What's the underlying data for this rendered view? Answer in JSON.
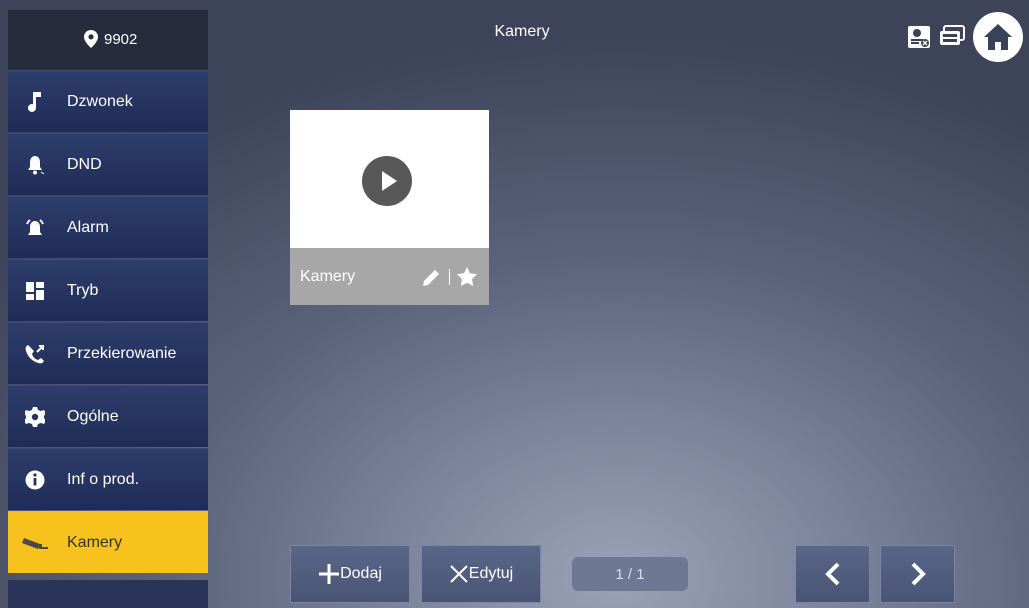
{
  "header": {
    "location_code": "9902",
    "title": "Kamery"
  },
  "sidebar": {
    "items": [
      {
        "label": "Dzwonek",
        "icon": "music-note-icon"
      },
      {
        "label": "DND",
        "icon": "bell-icon"
      },
      {
        "label": "Alarm",
        "icon": "alarm-icon"
      },
      {
        "label": "Tryb",
        "icon": "mode-grid-icon"
      },
      {
        "label": "Przekierowanie",
        "icon": "call-forward-icon"
      },
      {
        "label": "Ogólne",
        "icon": "gear-icon"
      },
      {
        "label": "Inf o prod.",
        "icon": "info-icon"
      },
      {
        "label": "Kamery",
        "icon": "camera-icon",
        "active": true
      }
    ]
  },
  "camera_card": {
    "name": "Kamery"
  },
  "toolbar": {
    "add_label": "Dodaj",
    "edit_label": "Edytuj",
    "page_indicator": "1 / 1"
  },
  "colors": {
    "active_accent": "#f7c21e",
    "sidebar_blue": "#25325c"
  }
}
